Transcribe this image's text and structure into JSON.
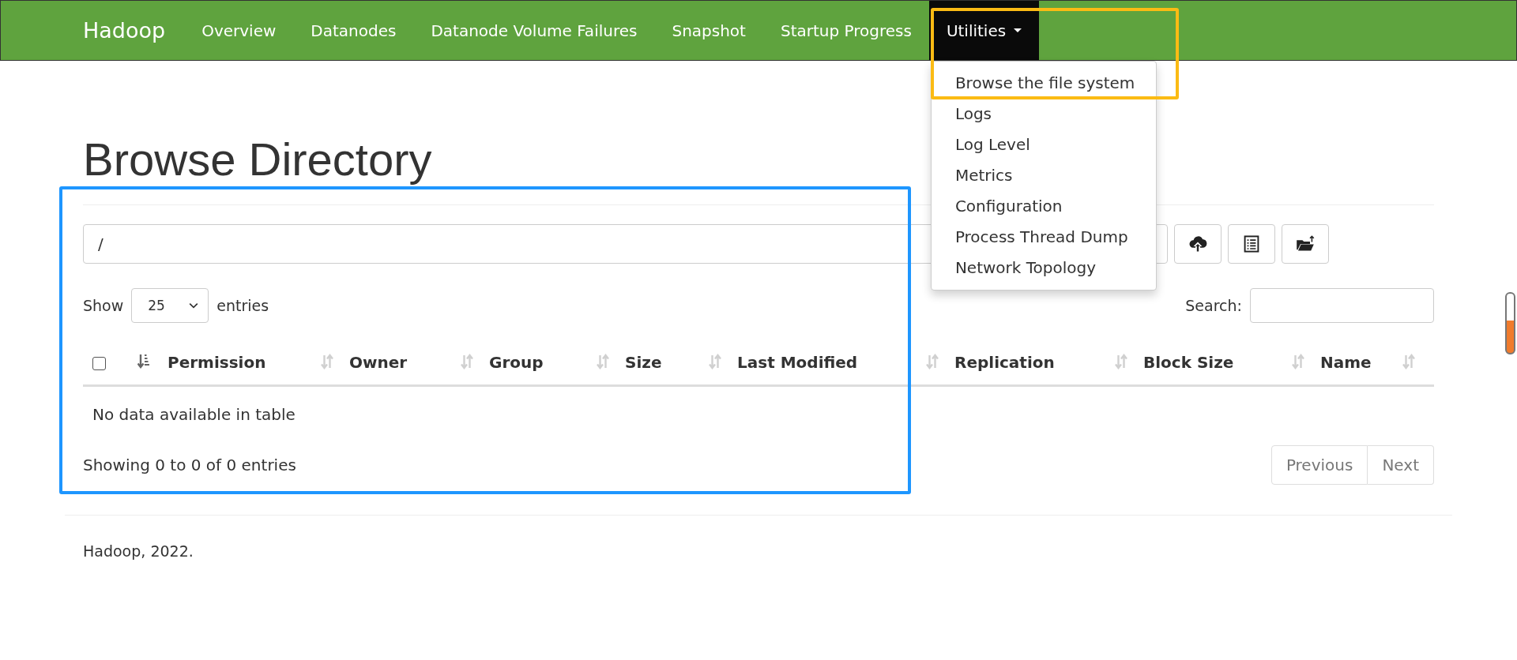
{
  "navbar": {
    "brand": "Hadoop",
    "items": [
      {
        "label": "Overview",
        "selected": false,
        "dropdown": false
      },
      {
        "label": "Datanodes",
        "selected": false,
        "dropdown": false
      },
      {
        "label": "Datanode Volume Failures",
        "selected": false,
        "dropdown": false
      },
      {
        "label": "Snapshot",
        "selected": false,
        "dropdown": false
      },
      {
        "label": "Startup Progress",
        "selected": false,
        "dropdown": false
      },
      {
        "label": "Utilities",
        "selected": true,
        "dropdown": true
      }
    ]
  },
  "dropdown_menu": {
    "items": [
      "Browse the file system",
      "Logs",
      "Log Level",
      "Metrics",
      "Configuration",
      "Process Thread Dump",
      "Network Topology"
    ]
  },
  "page_title": "Browse Directory",
  "path_field": {
    "value": "/"
  },
  "toolbar_buttons": [
    {
      "kind": "upload"
    },
    {
      "kind": "list"
    },
    {
      "kind": "folder"
    }
  ],
  "length_menu": {
    "before": "Show",
    "value": "25",
    "after": "entries"
  },
  "search": {
    "label": "Search:"
  },
  "table": {
    "select_all": {
      "checked": false,
      "sorted": true
    },
    "columns": [
      {
        "label": "Permission",
        "sorted": false
      },
      {
        "label": "Owner",
        "sorted": false
      },
      {
        "label": "Group",
        "sorted": false
      },
      {
        "label": "Size",
        "sorted": false
      },
      {
        "label": "Last Modified",
        "sorted": false
      },
      {
        "label": "Replication",
        "sorted": false
      },
      {
        "label": "Block Size",
        "sorted": false
      },
      {
        "label": "Name",
        "sorted": false
      }
    ],
    "empty_message": "No data available in table"
  },
  "info": "Showing 0 to 0 of 0 entries",
  "pagination": [
    {
      "label": "Previous",
      "disabled": true
    },
    {
      "label": "Next",
      "disabled": true
    }
  ],
  "footer": "Hadoop, 2022.",
  "highlights": [
    {
      "color": "#fbbb14"
    },
    {
      "color": "#1e96ff"
    }
  ]
}
